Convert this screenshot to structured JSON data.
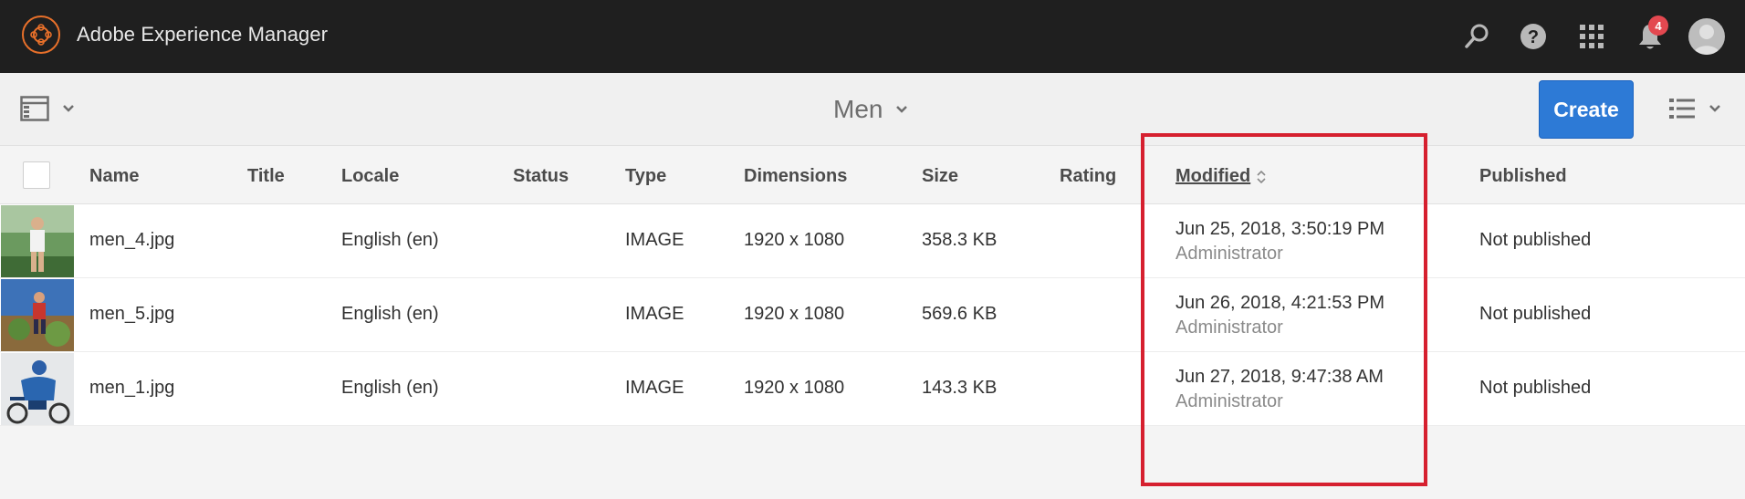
{
  "shell": {
    "app_title": "Adobe Experience Manager",
    "notification_count": "4",
    "accent_color": "#e8702a"
  },
  "actionbar": {
    "page_title": "Men",
    "create_label": "Create"
  },
  "table": {
    "columns": {
      "name": "Name",
      "title": "Title",
      "locale": "Locale",
      "status": "Status",
      "type": "Type",
      "dimensions": "Dimensions",
      "size": "Size",
      "rating": "Rating",
      "modified": "Modified",
      "published": "Published"
    },
    "rows": [
      {
        "name": "men_4.jpg",
        "locale": "English (en)",
        "type": "IMAGE",
        "dimensions": "1920 x 1080",
        "size": "358.3 KB",
        "modified": "Jun 25, 2018, 3:50:19 PM",
        "modified_by": "Administrator",
        "published": "Not published"
      },
      {
        "name": "men_5.jpg",
        "locale": "English (en)",
        "type": "IMAGE",
        "dimensions": "1920 x 1080",
        "size": "569.6 KB",
        "modified": "Jun 26, 2018, 4:21:53 PM",
        "modified_by": "Administrator",
        "published": "Not published"
      },
      {
        "name": "men_1.jpg",
        "locale": "English (en)",
        "type": "IMAGE",
        "dimensions": "1920 x 1080",
        "size": "143.3 KB",
        "modified": "Jun 27, 2018, 9:47:38 AM",
        "modified_by": "Administrator",
        "published": "Not published"
      }
    ]
  },
  "highlight_color": "#d6202f"
}
